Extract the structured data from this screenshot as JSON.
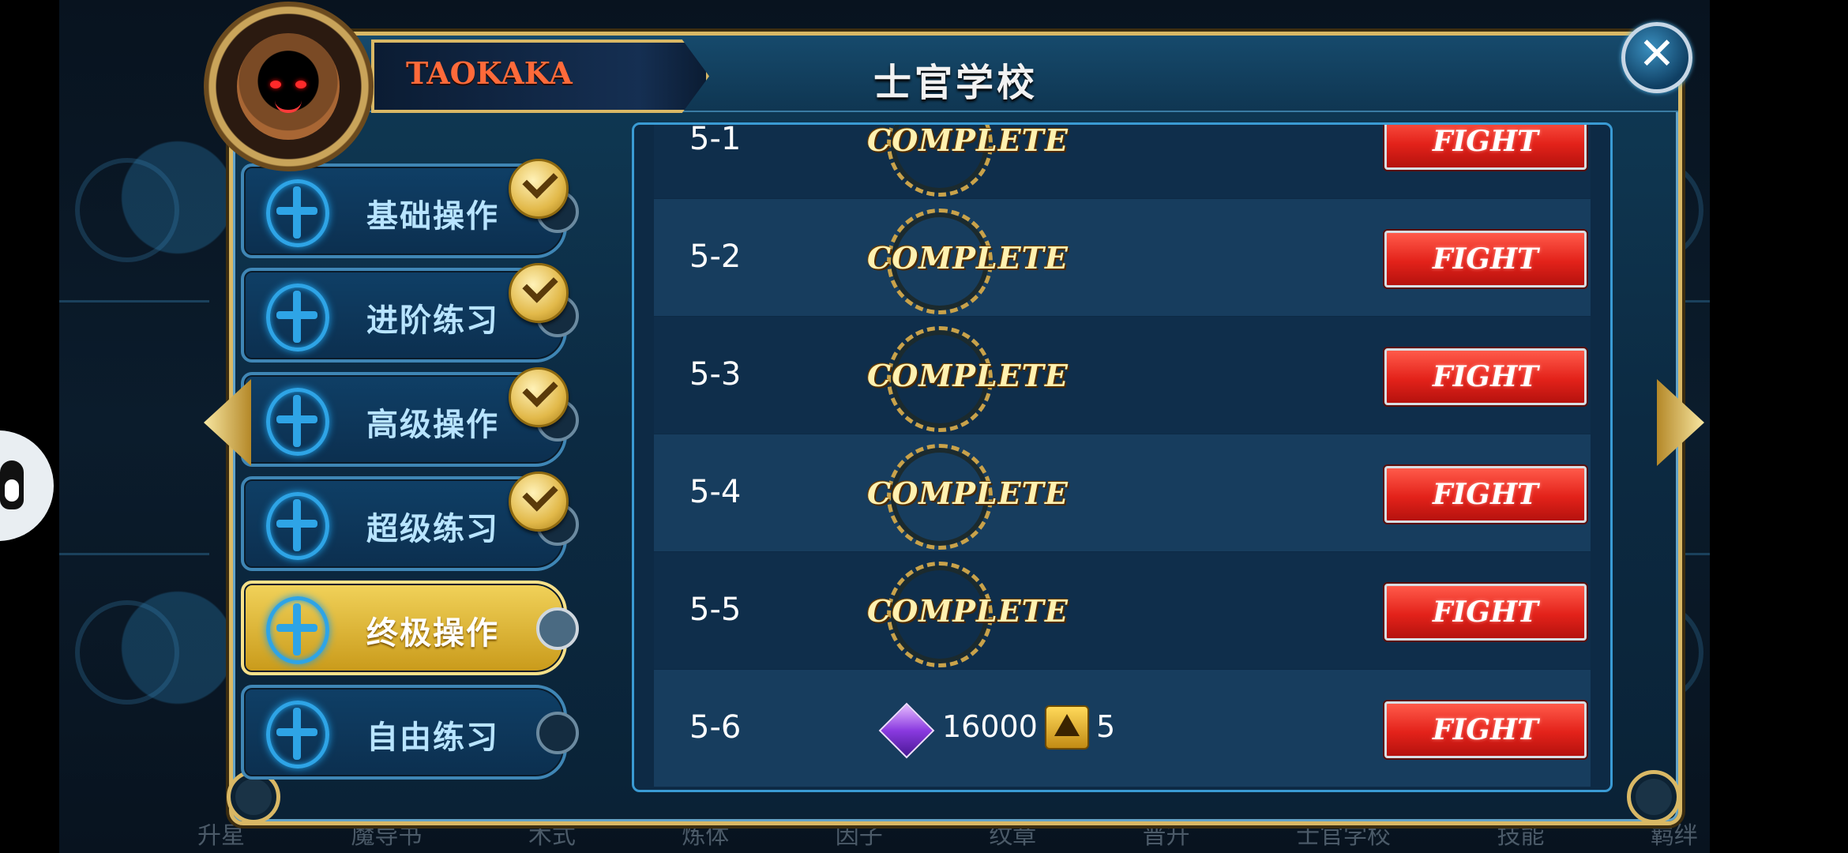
{
  "panel": {
    "title": "士官学校"
  },
  "player": {
    "name": "TAOKAKA"
  },
  "menu": [
    {
      "label": "基础操作",
      "completed": true,
      "active": false
    },
    {
      "label": "进阶练习",
      "completed": true,
      "active": false
    },
    {
      "label": "高级操作",
      "completed": true,
      "active": false
    },
    {
      "label": "超级练习",
      "completed": true,
      "active": false
    },
    {
      "label": "终极操作",
      "completed": false,
      "active": true
    },
    {
      "label": "自由练习",
      "completed": false,
      "active": false
    }
  ],
  "stages": [
    {
      "id": "5-1",
      "status": "COMPLETE",
      "action": "FIGHT"
    },
    {
      "id": "5-2",
      "status": "COMPLETE",
      "action": "FIGHT"
    },
    {
      "id": "5-3",
      "status": "COMPLETE",
      "action": "FIGHT"
    },
    {
      "id": "5-4",
      "status": "COMPLETE",
      "action": "FIGHT"
    },
    {
      "id": "5-5",
      "status": "COMPLETE",
      "action": "FIGHT"
    },
    {
      "id": "5-6",
      "status": "",
      "action": "FIGHT",
      "reward_gems": "16000",
      "reward_tokens": "5"
    }
  ],
  "bottom_nav": [
    "升星",
    "魔导书",
    "术式",
    "炼体",
    "因子",
    "纹章",
    "晋升",
    "士官学校",
    "技能",
    "羁绊"
  ],
  "colors": {
    "accent_gold": "#d9b865",
    "fight_red": "#e3221a",
    "active_tab": "#f1d25a"
  }
}
